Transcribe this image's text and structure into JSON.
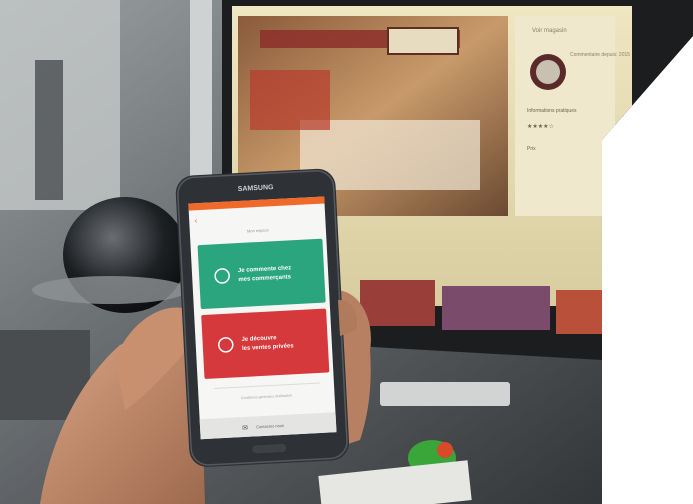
{
  "photo": {
    "subject": "hand holding smartphone in front of computer monitor",
    "colors": {
      "background_white": "#ffffff",
      "monitor_screen": "#ded3a7",
      "phone_body": "#2e3135",
      "green_card": "#2aa57e",
      "red_card": "#d6393b",
      "phone_topbar": "#ef6a2a",
      "skin": "#c38a6b"
    },
    "icons": [
      "location-pin-icon",
      "coins-icon",
      "envelope-icon",
      "back-arrow-icon"
    ]
  },
  "monitor": {
    "profile_header": "Voir magasin",
    "profile_link": "Commentaire depuis: 2015",
    "section_label": "Informations pratiques",
    "section_sub": "Prix",
    "rating_text": "★★★★☆"
  },
  "phone": {
    "brand": "SAMSUNG",
    "screen_title": "Mon espace",
    "card_green_line1": "Je commente chez",
    "card_green_line2": "mes commerçants",
    "card_red_line1": "Je découvre",
    "card_red_line2": "les ventes privées",
    "footer_link": "Conditions générales d'utilisation",
    "bottom_bar": "Contactez-nous"
  }
}
